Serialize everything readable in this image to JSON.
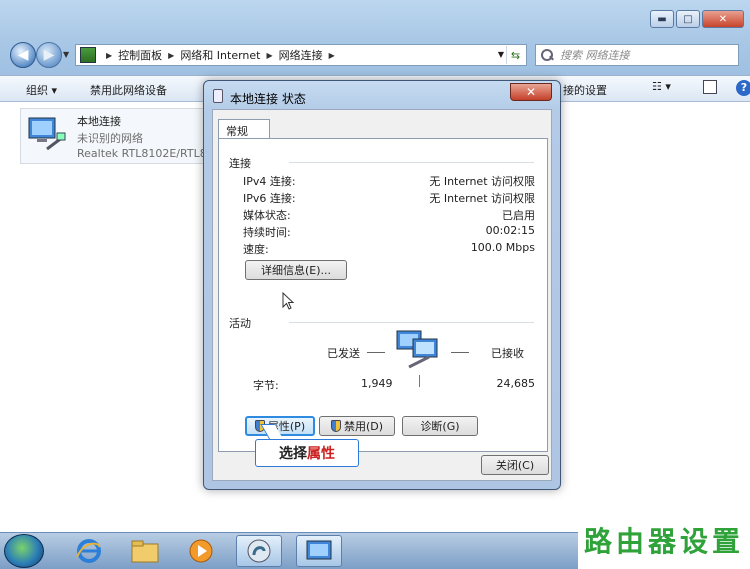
{
  "address_bar": {
    "breadcrumbs": [
      "控制面板",
      "网络和 Internet",
      "网络连接"
    ],
    "search_placeholder": "搜索 网络连接"
  },
  "command_bar": {
    "organize": "组织 ▾",
    "disable": "禁用此网络设备",
    "settings": "接的设置",
    "help": "?"
  },
  "connection_item": {
    "name": "本地连接",
    "status": "未识别的网络",
    "adapter": "Realtek RTL8102E/RTL8"
  },
  "dialog": {
    "title": "本地连接 状态",
    "close_glyph": "✕",
    "tab": "常规",
    "connection_group": "连接",
    "rows": [
      {
        "label": "IPv4 连接:",
        "value": "无 Internet 访问权限"
      },
      {
        "label": "IPv6 连接:",
        "value": "无 Internet 访问权限"
      },
      {
        "label": "媒体状态:",
        "value": "已启用"
      },
      {
        "label": "持续时间:",
        "value": "00:02:15"
      },
      {
        "label": "速度:",
        "value": "100.0 Mbps"
      }
    ],
    "details_button": "详细信息(E)...",
    "activity_group": "活动",
    "sent_label": "已发送",
    "received_label": "已接收",
    "bytes_label": "字节:",
    "bytes_sent": "1,949",
    "bytes_received": "24,685",
    "properties_button": "属性(P)",
    "disable_button": "禁用(D)",
    "diagnose_button": "诊断(G)",
    "close_button": "关闭(C)"
  },
  "callout": {
    "text_a": "选择",
    "text_b": "属性"
  },
  "watermark": "路由器设置",
  "colors": {
    "accent": "#2d7ad8",
    "callout_red": "#cc2020",
    "watermark_green": "#2fa23a"
  }
}
